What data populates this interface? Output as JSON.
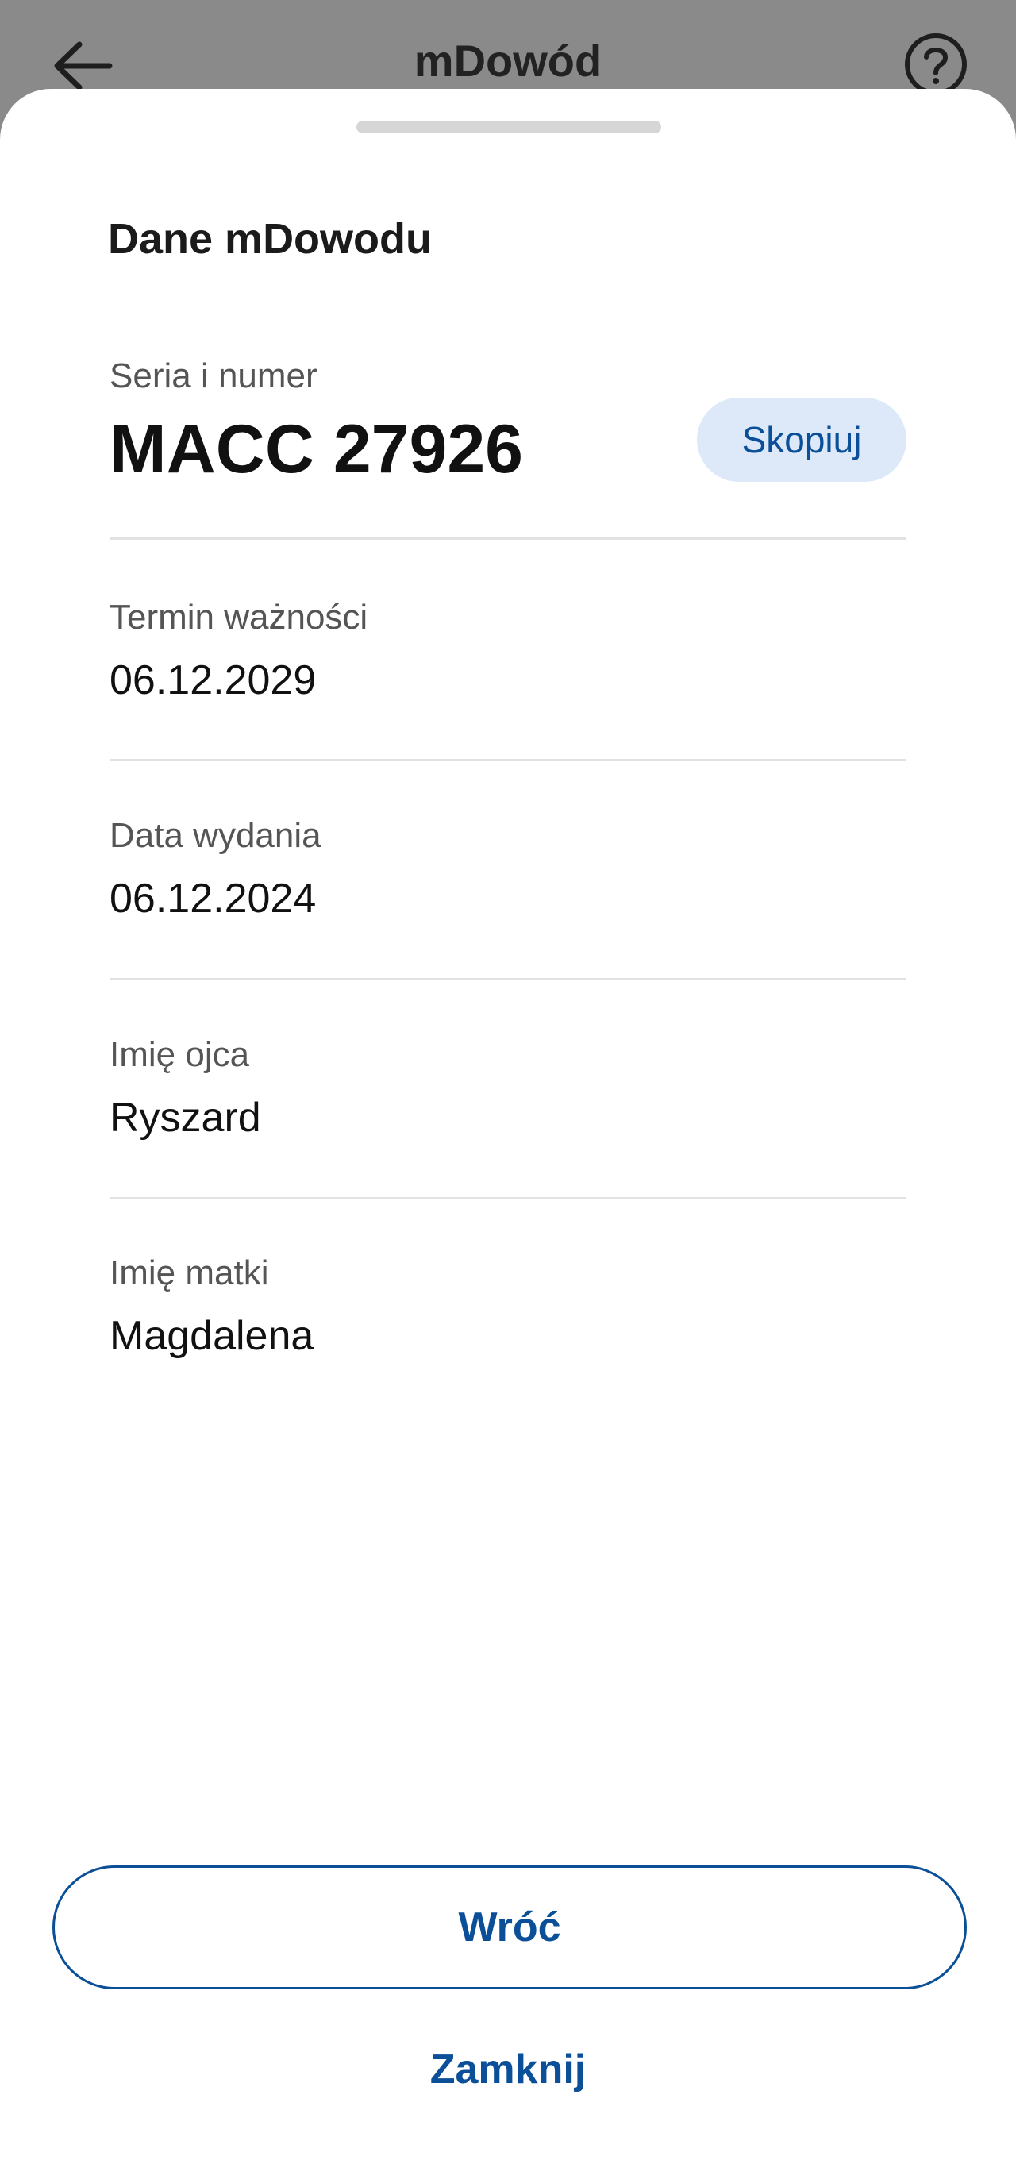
{
  "header": {
    "title": "mDowód",
    "back_icon": "arrow-left-icon",
    "help_icon": "question-circle-icon"
  },
  "sheet": {
    "title": "Dane mDowodu",
    "fields": [
      {
        "label": "Seria i numer",
        "value": "MACC 27926"
      },
      {
        "label": "Termin ważności",
        "value": "06.12.2029"
      },
      {
        "label": "Data wydania",
        "value": "06.12.2024"
      },
      {
        "label": "Imię ojca",
        "value": "Ryszard"
      },
      {
        "label": "Imię matki",
        "value": "Magdalena"
      }
    ],
    "copy_label": "Skopiuj"
  },
  "actions": {
    "back_label": "Wróć",
    "close_label": "Zamknij"
  },
  "colors": {
    "accent": "#0a4f97",
    "copy_bg": "#dde9f8",
    "overlay": "#8a8a8a"
  }
}
